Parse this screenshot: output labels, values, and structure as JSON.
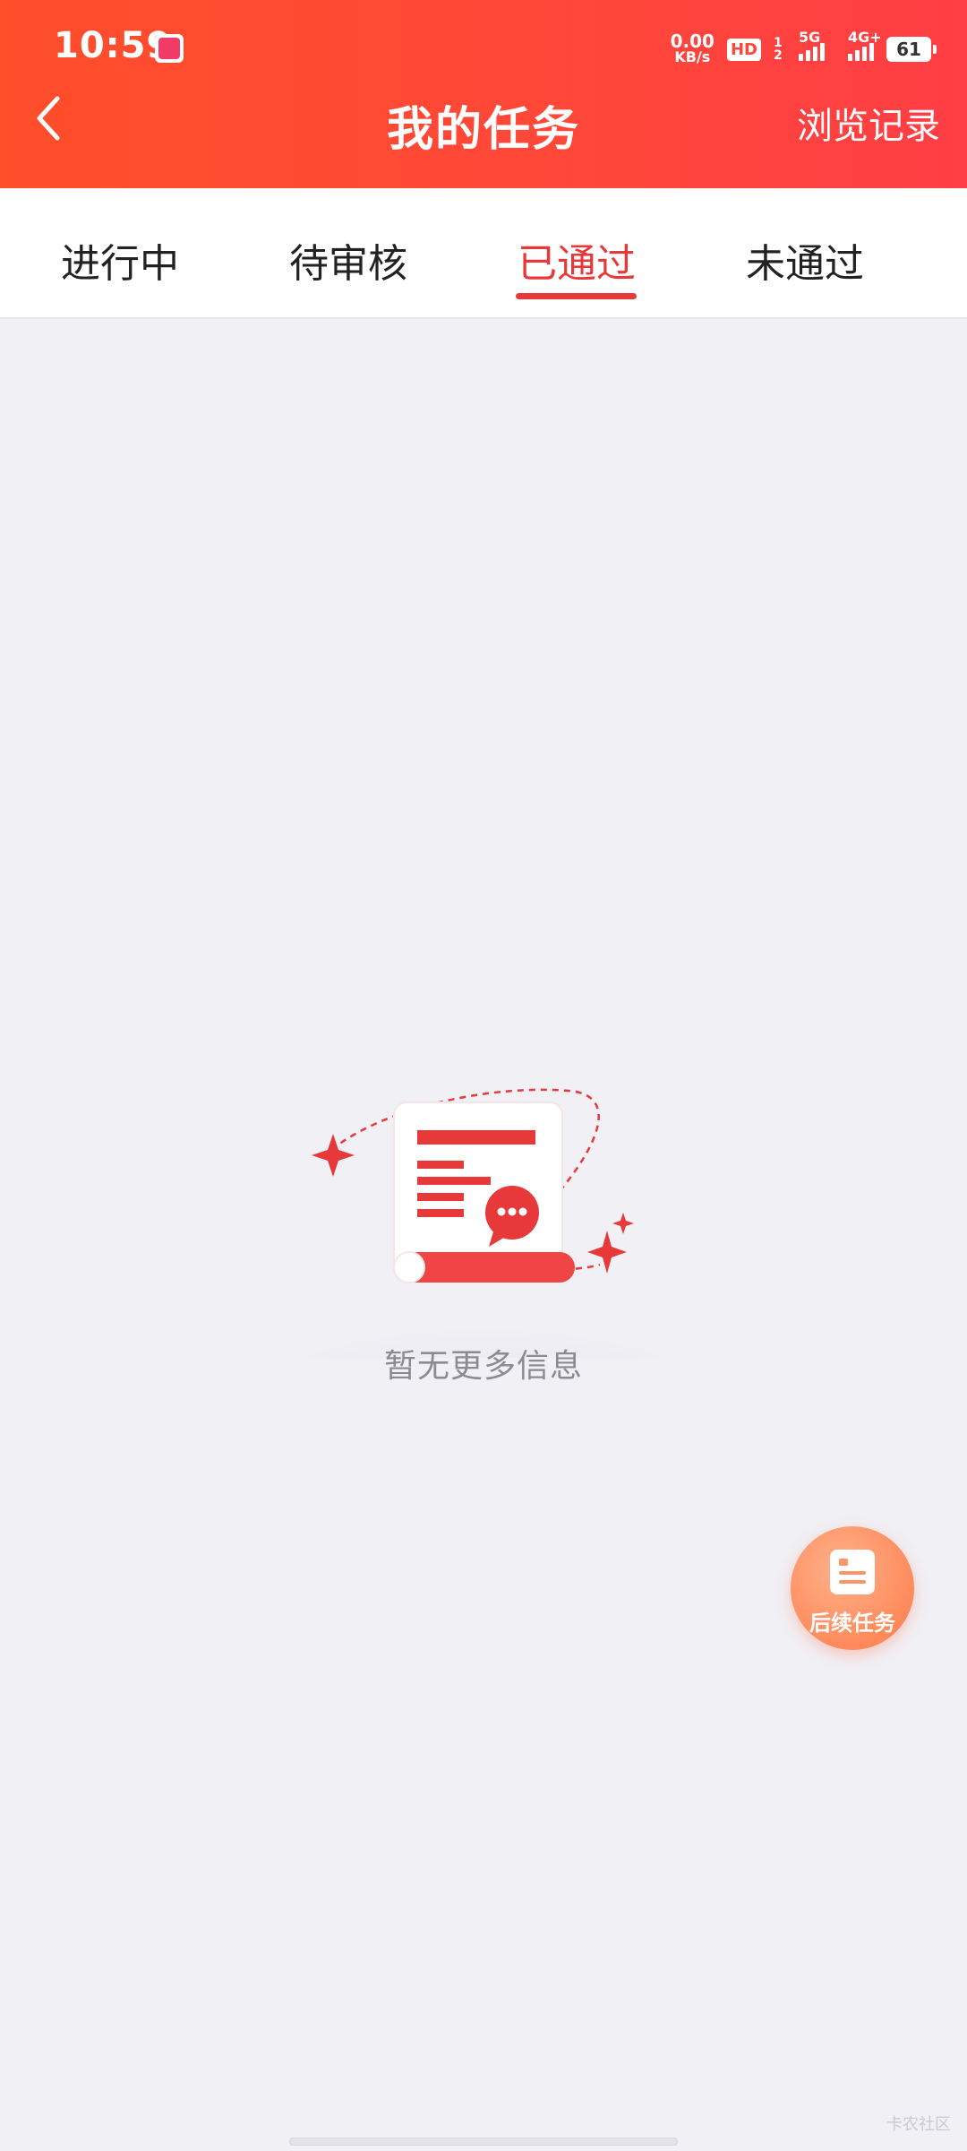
{
  "status_bar": {
    "time": "10:59",
    "speed_value": "0.00",
    "speed_unit": "KB/s",
    "hd_label": "HD",
    "sim_label": "1 2",
    "signal1_label": "5G",
    "signal2_label": "4G+",
    "battery": "61"
  },
  "header": {
    "title": "我的任务",
    "history_link": "浏览记录",
    "bg_start": "#FF4E2A",
    "bg_end": "#FF3E45"
  },
  "tabs": {
    "items": [
      {
        "label": "进行中"
      },
      {
        "label": "待审核"
      },
      {
        "label": "已通过"
      },
      {
        "label": "未通过"
      }
    ],
    "active_index": 2,
    "active_color": "#E8393A"
  },
  "empty_state": {
    "message": "暂无更多信息",
    "illustration": "document-chat-illustration"
  },
  "fab": {
    "label": "后续任务",
    "icon": "document-icon"
  },
  "watermark": "卡农社区"
}
